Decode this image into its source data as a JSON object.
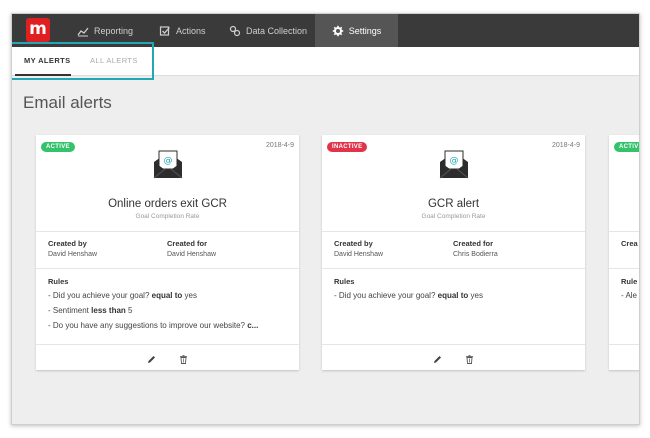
{
  "brand": {
    "logo_letter": "m",
    "color": "#e02020"
  },
  "nav": {
    "items": [
      {
        "label": "Reporting",
        "icon": "chart-line-icon"
      },
      {
        "label": "Actions",
        "icon": "checkbox-icon"
      },
      {
        "label": "Data Collection",
        "icon": "link-icon"
      },
      {
        "label": "Settings",
        "icon": "gear-icon",
        "active": true
      }
    ]
  },
  "subtabs": [
    {
      "label": "MY ALERTS",
      "active": true
    },
    {
      "label": "ALL ALERTS",
      "active": false
    }
  ],
  "page": {
    "title": "Email alerts"
  },
  "cards": [
    {
      "status": "ACTIVE",
      "date": "2018-4-9",
      "title": "Online orders exit GCR",
      "subtitle": "Goal Completion Rate",
      "created_by_label": "Created by",
      "created_by": "David Henshaw",
      "created_for_label": "Created for",
      "created_for": "David Henshaw",
      "rules_label": "Rules",
      "rules": [
        {
          "prefix": "- Did you achieve your goal? ",
          "op": "equal to",
          "value": " yes"
        },
        {
          "prefix": "- Sentiment ",
          "op": "less than",
          "value": " 5"
        },
        {
          "prefix": "- Do you have any suggestions to improve our website? ",
          "op": "c...",
          "value": ""
        }
      ]
    },
    {
      "status": "INACTIVE",
      "date": "2018-4-9",
      "title": "GCR alert",
      "subtitle": "Goal Completion Rate",
      "created_by_label": "Created by",
      "created_by": "David Henshaw",
      "created_for_label": "Created for",
      "created_for": "Chris Bodierra",
      "rules_label": "Rules",
      "rules": [
        {
          "prefix": "- Did you achieve your goal? ",
          "op": "equal to",
          "value": " yes"
        }
      ]
    },
    {
      "status": "ACTIV",
      "created_by_label": "Crea",
      "rules_label": "Rule",
      "rule_fragment": "- Ale"
    }
  ],
  "colors": {
    "accent_box": "#22a7b5",
    "active": "#34c26a",
    "inactive": "#e0344a",
    "nav_bg": "#3a3a3a"
  }
}
